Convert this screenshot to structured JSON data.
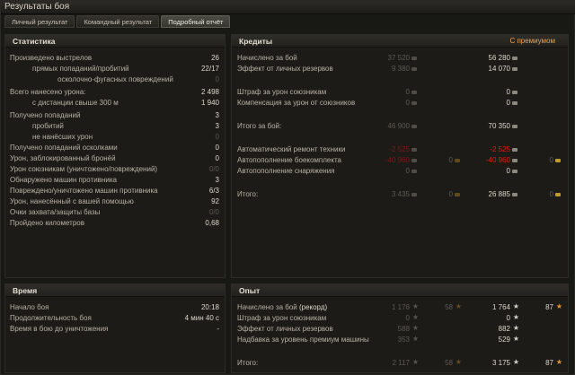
{
  "window": {
    "title": "Результаты боя"
  },
  "tabs": [
    {
      "label": "Личный результат"
    },
    {
      "label": "Командный результат"
    },
    {
      "label": "Подробный отчёт"
    }
  ],
  "stats": {
    "title": "Статистика",
    "rows": [
      {
        "label": "Произведено выстрелов",
        "value": "26"
      },
      {
        "label": "прямых попаданий/пробитий",
        "value": "22/17"
      },
      {
        "label": "осколочно-фугасных повреждений",
        "value": "0"
      },
      {
        "label": "Всего нанесено урона:",
        "value": "2 498"
      },
      {
        "label": "с дистанции свыше 300 м",
        "value": "1 940"
      },
      {
        "label": "Получено попаданий",
        "value": "3"
      },
      {
        "label": "пробитий",
        "value": "3"
      },
      {
        "label": "не нанёсших урон",
        "value": "0"
      },
      {
        "label": "Получено попаданий осколками",
        "value": "0"
      },
      {
        "label": "Урон, заблокированный бронёй",
        "value": "0"
      },
      {
        "label": "Урон союзникам (уничтожено/повреждений)",
        "value": "0/0"
      },
      {
        "label": "Обнаружено машин противника",
        "value": "3"
      },
      {
        "label": "Повреждено/уничтожено машин противника",
        "value": "6/3"
      },
      {
        "label": "Урон, нанесённый с вашей помощью",
        "value": "92"
      },
      {
        "label": "Очки захвата/защиты базы",
        "value": "0/0"
      },
      {
        "label": "Пройдено километров",
        "value": "0,68"
      }
    ]
  },
  "credits": {
    "title": "Кредиты",
    "premium_label": "С премиумом",
    "rows": [
      {
        "label": "Начислено за бой",
        "base": "37 520",
        "prem": "56 280",
        "bg": "",
        "pg": ""
      },
      {
        "label": "Эффект от личных резервов",
        "base": "9 380",
        "prem": "14 070",
        "bg": "",
        "pg": ""
      },
      {
        "label": "Штраф за урон союзникам",
        "base": "0",
        "prem": "0",
        "bg": "",
        "pg": ""
      },
      {
        "label": "Компенсация за урон от союзников",
        "base": "0",
        "prem": "0",
        "bg": "",
        "pg": ""
      },
      {
        "label": "Итого за бой:",
        "base": "46 900",
        "prem": "70 350",
        "bg": "",
        "pg": ""
      },
      {
        "label": "Автоматический ремонт техники",
        "base": "-2 525",
        "prem": "-2 525",
        "bg": "",
        "pg": ""
      },
      {
        "label": "Автопополнение боекомплекта",
        "base": "-40 960",
        "prem": "-40 960",
        "bg": "0",
        "pg": "0"
      },
      {
        "label": "Автопополнение снаряжения",
        "base": "0",
        "prem": "0",
        "bg": "",
        "pg": ""
      },
      {
        "label": "Итого:",
        "base": "3 435",
        "prem": "26 885",
        "bg": "0",
        "pg": "0"
      }
    ]
  },
  "time": {
    "title": "Время",
    "rows": [
      {
        "label": "Начало боя",
        "value": "20:18"
      },
      {
        "label": "Продолжительность боя",
        "value": "4 мин 40 с"
      },
      {
        "label": "Время в бою до уничтожения",
        "value": "-"
      }
    ]
  },
  "exp": {
    "title": "Опыт",
    "rows": [
      {
        "label": "Начислено за бой",
        "label_b": " (рекорд)",
        "base": "1 176",
        "free": "58",
        "prem": "1 764",
        "pfree": "87"
      },
      {
        "label": "Штраф за урон союзникам",
        "label_b": "",
        "base": "0",
        "free": "",
        "prem": "0",
        "pfree": ""
      },
      {
        "label": "Эффект от личных резервов",
        "label_b": "",
        "base": "588",
        "free": "",
        "prem": "882",
        "pfree": ""
      },
      {
        "label": "Надбавка за уровень премиум машины",
        "label_b": "",
        "base": "353",
        "free": "",
        "prem": "529",
        "pfree": ""
      },
      {
        "label": "Итого:",
        "label_b": "",
        "base": "2 117",
        "free": "58",
        "prem": "3 175",
        "pfree": "87"
      }
    ]
  }
}
